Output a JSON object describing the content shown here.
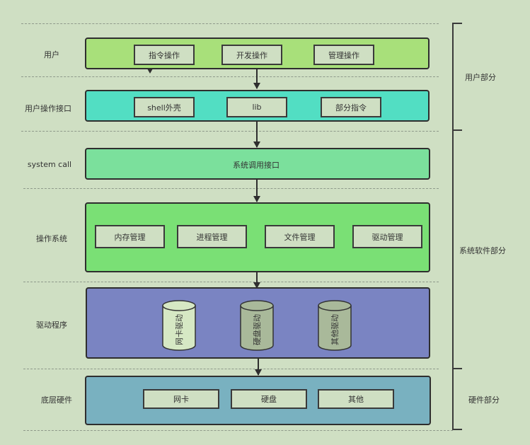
{
  "rows": {
    "user": {
      "label": "用户",
      "items": [
        "指令操作",
        "开发操作",
        "管理操作"
      ]
    },
    "user_interface": {
      "label": "用户操作接口",
      "items": [
        "shell外壳",
        "lib",
        "部分指令"
      ]
    },
    "system_call": {
      "label": "system call",
      "text": "系统调用接口"
    },
    "os": {
      "label": "操作系统",
      "items": [
        "内存管理",
        "进程管理",
        "文件管理",
        "驱动管理"
      ]
    },
    "drivers": {
      "label": "驱动程序",
      "items": [
        "网卡驱动",
        "硬盘驱动",
        "其他驱动"
      ]
    },
    "hardware": {
      "label": "底层硬件",
      "items": [
        "网卡",
        "硬盘",
        "其他"
      ]
    }
  },
  "groups": [
    "用户部分",
    "系统软件部分",
    "硬件部分"
  ],
  "colors": {
    "background": "#cfdfc3",
    "user_layer": "#a8e07a",
    "interface_layer": "#52dec3",
    "syscall_layer": "#7be09c",
    "os_layer": "#7ae075",
    "driver_layer": "#7a84c2",
    "hardware_layer": "#79b1c0"
  }
}
